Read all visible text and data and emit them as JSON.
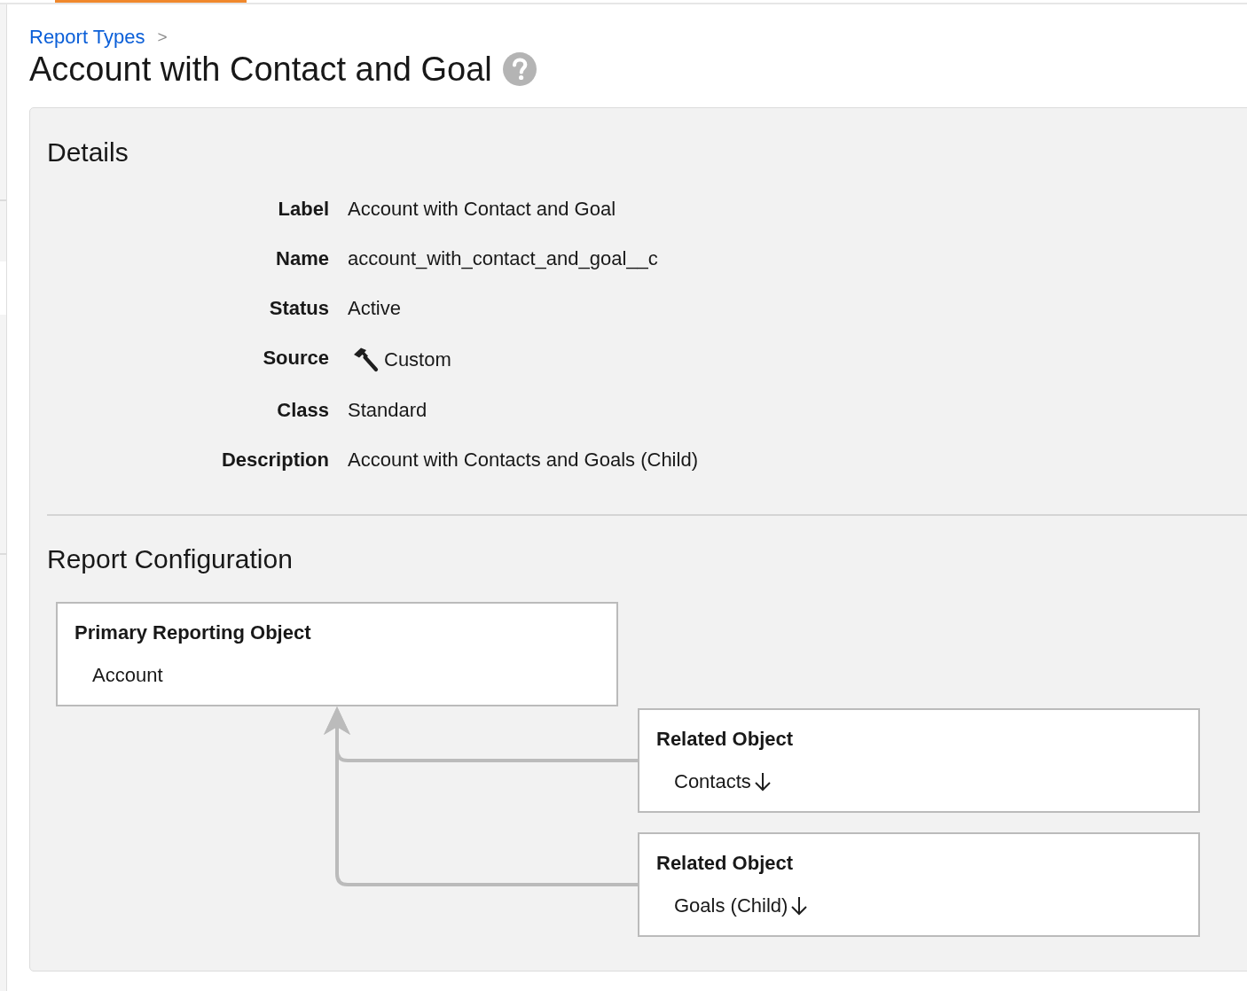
{
  "breadcrumb": {
    "link": "Report Types",
    "separator": ">"
  },
  "page_title": "Account with Contact and Goal",
  "details": {
    "heading": "Details",
    "fields": [
      {
        "label": "Label",
        "value": "Account with Contact and Goal",
        "kind": "plain"
      },
      {
        "label": "Name",
        "value": "account_with_contact_and_goal__c",
        "kind": "plain"
      },
      {
        "label": "Status",
        "value": "Active",
        "kind": "plain"
      },
      {
        "label": "Source",
        "value": "Custom",
        "kind": "tool"
      },
      {
        "label": "Class",
        "value": "Standard",
        "kind": "plain"
      },
      {
        "label": "Description",
        "value": "Account with Contacts and Goals (Child)",
        "kind": "plain"
      }
    ]
  },
  "report_configuration": {
    "heading": "Report Configuration",
    "primary_object": {
      "title": "Primary Reporting Object",
      "value": "Account"
    },
    "related_objects": [
      {
        "title": "Related Object",
        "value": "Contacts"
      },
      {
        "title": "Related Object",
        "value": "Goals (Child)"
      }
    ]
  }
}
